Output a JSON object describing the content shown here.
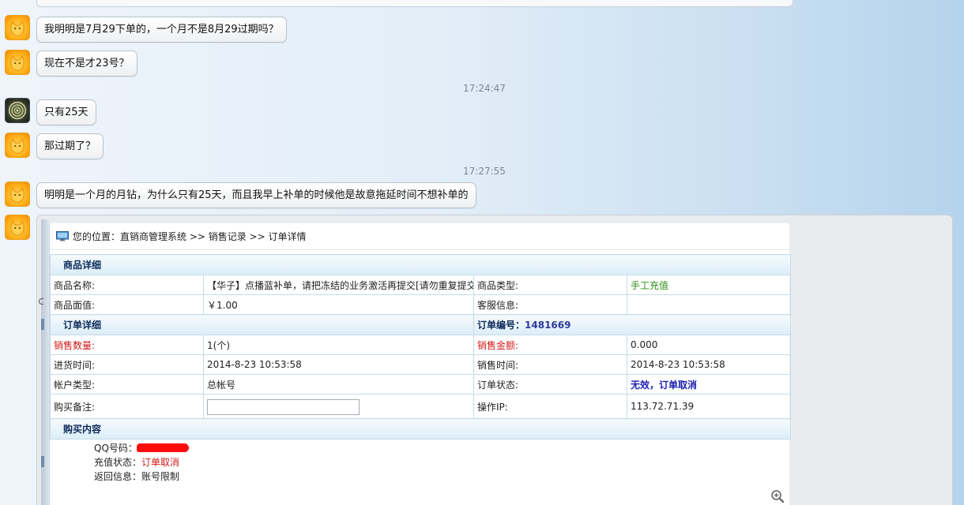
{
  "messages": [
    {
      "avatar": "fox-avatar",
      "text": "我明明是7月29下单的，一个月不是8月29过期吗？"
    },
    {
      "avatar": "fox-avatar",
      "text": "现在不是才23号？"
    },
    {
      "timestamp": "17:24:47"
    },
    {
      "avatar": "coil-avatar",
      "text": "只有25天"
    },
    {
      "avatar": "fox-avatar",
      "text": "那过期了？"
    },
    {
      "timestamp": "17:27:55"
    },
    {
      "avatar": "fox-avatar",
      "text": "明明是一个月的月钻，为什么只有25天，而且我早上补单的时候他是故意拖延时间不想补单的"
    }
  ],
  "screenshot": {
    "breadcrumb": "您的位置：直销商管理系统 >> 销售记录 >> 订单详情",
    "product_section": "商品详细",
    "product_name_label": "商品名称:",
    "product_name_value": "【华子】点播蓝补单，请把冻结的业务激活再提交[请勿重复提交]",
    "product_type_label": "商品类型:",
    "product_type_value": "手工充值",
    "face_value_label": "商品面值:",
    "face_value_value": "￥1.00",
    "service_info_label": "客服信息:",
    "service_info_value": "",
    "order_section": "订单详细",
    "order_number_label": "订单编号：",
    "order_number_value": "1481669",
    "sale_qty_label": "销售数量:",
    "sale_qty_value": "1(个)",
    "sale_amount_label": "销售金额:",
    "sale_amount_value": "0.000",
    "purchase_time_label": "进货时间:",
    "purchase_time_value": "2014-8-23 10:53:58",
    "sale_time_label": "销售时间:",
    "sale_time_value": "2014-8-23 10:53:58",
    "account_type_label": "帐户类型:",
    "account_type_value": "总帐号",
    "order_status_label": "订单状态:",
    "order_status_value": "无效，订单取消",
    "remark_label": "购买备注:",
    "remark_value": "",
    "operator_ip_label": "操作IP:",
    "operator_ip_value": "113.72.71.39",
    "purchase_section": "购买内容",
    "qq_label": "QQ号码：",
    "recharge_status_label": "充值状态：",
    "recharge_status_value": "订单取消",
    "return_info_label": "返回信息：",
    "return_info_value": "账号限制"
  },
  "colors": {
    "accent_red": "#d11a1a",
    "status_blue": "#1a1fb0",
    "type_green": "#2f8f1a",
    "section_text": "#0d2a5a"
  },
  "icons": [
    "fox-avatar",
    "coil-avatar",
    "monitor-icon",
    "zoom-in-icon"
  ]
}
